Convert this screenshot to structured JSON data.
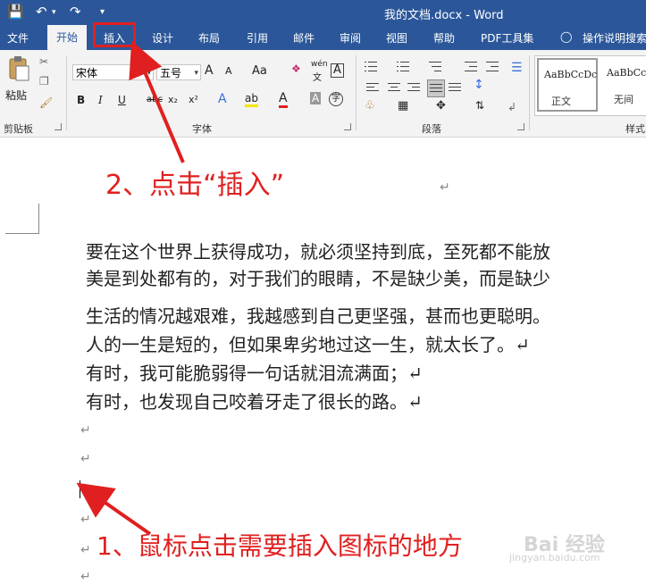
{
  "titlebar": {
    "title": "我的文档.docx  -  Word",
    "icons": [
      "save-icon",
      "undo-icon",
      "redo-icon",
      "customize-icon"
    ]
  },
  "tabs": [
    "文件",
    "开始",
    "插入",
    "设计",
    "布局",
    "引用",
    "邮件",
    "审阅",
    "视图",
    "帮助",
    "PDF工具集",
    "操作说明搜索"
  ],
  "active_tab": "开始",
  "ribbon": {
    "clipboard": {
      "paste": "粘贴",
      "label": "剪贴板"
    },
    "font": {
      "font_name": "宋体",
      "font_size": "五号",
      "grow": "A",
      "shrink": "A",
      "case": "Aa",
      "phonetic": "wén",
      "phonetic_char": "文",
      "border_char": "A",
      "bold": "B",
      "italic": "I",
      "underline": "U",
      "strike": "abc",
      "subscript": "x₂",
      "superscript": "x²",
      "effects": "A",
      "highlight": "ab",
      "font_color": "A",
      "shading": "A",
      "enclose": "字",
      "label": "字体"
    },
    "paragraph": {
      "label": "段落"
    },
    "styles": {
      "sample": "AaBbCcDc",
      "items": [
        "正文",
        "无间"
      ],
      "label": "样式"
    }
  },
  "document": {
    "lines": [
      "要在这个世界上获得成功，就必须坚持到底，至死都不能放",
      "美是到处都有的，对于我们的眼睛，不是缺少美，而是缺少",
      "生活的情况越艰难，我越感到自己更坚强，甚而也更聪明。",
      "人的一生是短的，但如果卑劣地过这一生，就太长了。↵",
      "有时，我可能脆弱得一句话就泪流满面；↵",
      "有时，也发现自己咬着牙走了很长的路。↵"
    ],
    "para_mark": "↵"
  },
  "annotations": {
    "step2": "2、点击“插入”",
    "step1": "1、鼠标点击需要插入图标的地方",
    "color": "#e02020"
  },
  "watermark": {
    "main": "Bai 经验",
    "sub": "jingyan.baidu.com"
  }
}
